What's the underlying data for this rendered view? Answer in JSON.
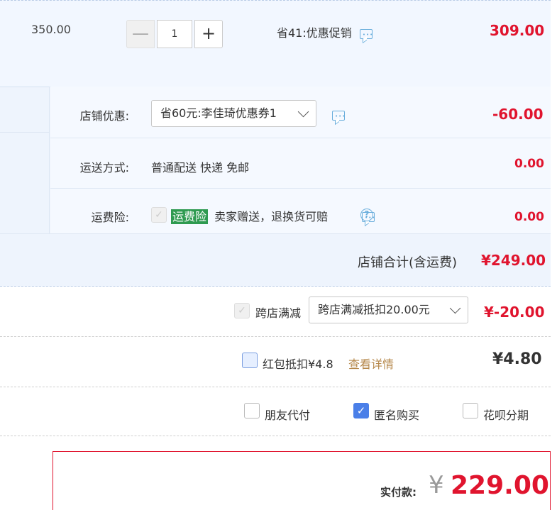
{
  "item": {
    "unit_price": "350.00",
    "quantity": "1",
    "minus_symbol": "—",
    "plus_symbol": "+",
    "promotion": "省41:优惠促销",
    "subtotal": "309.00"
  },
  "shop": {
    "coupon_label": "店铺优惠:",
    "coupon_selected": "省60元:李佳琦优惠券1",
    "coupon_amount": "-60.00",
    "shipping_label": "运送方式:",
    "shipping_value": "普通配送 快递 免邮",
    "shipping_amount": "0.00",
    "insurance_label": "运费险:",
    "insurance_tag": "运费险",
    "insurance_desc": "卖家赠送，退换货可赔",
    "insurance_amount": "0.00",
    "total_label": "店铺合计(含运费)",
    "total_amount": "¥249.00"
  },
  "cross_store": {
    "label": "跨店满减",
    "selected": "跨店满减抵扣20.00元",
    "amount": "¥-20.00"
  },
  "red_packet": {
    "label": "红包抵扣¥4.8",
    "details_link": "查看详情",
    "amount": "¥4.80"
  },
  "options": {
    "friend_pay": "朋友代付",
    "anonymous": "匿名购买",
    "huabei": "花呗分期"
  },
  "final": {
    "label": "实付款:",
    "currency": "¥",
    "amount": "229.00"
  },
  "colors": {
    "price_red": "#e0142e",
    "link_orange": "#b5874a",
    "checkbox_blue": "#4a7fe8",
    "insurance_green": "#2e9a50"
  }
}
